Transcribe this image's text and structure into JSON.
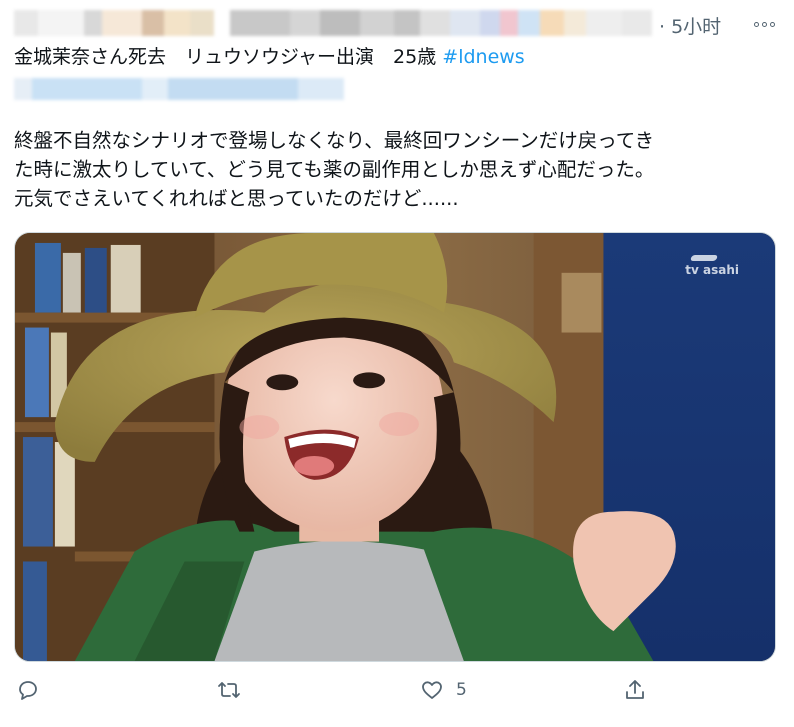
{
  "tweet": {
    "time": "· 5小时",
    "headline_text": "金城茉奈さん死去　リュウソウジャー出演　25歳 ",
    "hashtag": "#ldnews",
    "body_lines": [
      "終盤不自然なシナリオで登場しなくなり、最終回ワンシーンだけ戻ってき",
      "た時に激太りしていて、どう見ても薬の副作用としか思えず心配だった。",
      "元気でさえいてくれればと思っていたのだけど......"
    ],
    "media": {
      "watermark": "tv asahi"
    },
    "actions": {
      "reply_icon": "reply-icon",
      "retweet_icon": "retweet-icon",
      "like_icon": "heart-icon",
      "like_count": "5",
      "share_icon": "share-icon"
    }
  },
  "colors": {
    "text": "#0f1419",
    "secondary": "#536471",
    "link": "#1d9bf0",
    "border": "#cfd9de"
  }
}
